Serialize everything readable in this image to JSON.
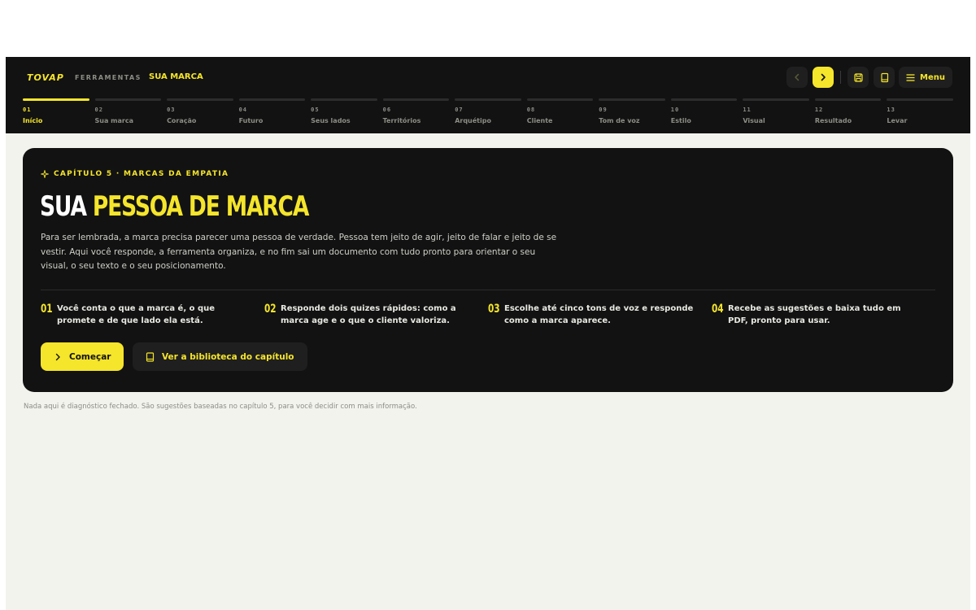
{
  "header": {
    "logo": "TOVAP",
    "tools_label": "FERRAMENTAS",
    "brand_link": "SUA MARCA",
    "menu_label": "Menu"
  },
  "icons": {
    "prev": "chevron-left-icon",
    "next": "chevron-right-icon",
    "save": "save-icon",
    "library": "book-icon",
    "menu": "hamburger-icon"
  },
  "steps": [
    {
      "num": "01",
      "label": "Início",
      "active": true
    },
    {
      "num": "02",
      "label": "Sua marca"
    },
    {
      "num": "03",
      "label": "Coração"
    },
    {
      "num": "04",
      "label": "Futuro"
    },
    {
      "num": "05",
      "label": "Seus lados"
    },
    {
      "num": "06",
      "label": "Territórios"
    },
    {
      "num": "07",
      "label": "Arquétipo"
    },
    {
      "num": "08",
      "label": "Cliente"
    },
    {
      "num": "09",
      "label": "Tom de voz"
    },
    {
      "num": "10",
      "label": "Estilo"
    },
    {
      "num": "11",
      "label": "Visual"
    },
    {
      "num": "12",
      "label": "Resultado"
    },
    {
      "num": "13",
      "label": "Levar"
    }
  ],
  "hero": {
    "eyebrow": "CAPÍTULO 5 · MARCAS DA EMPATIA",
    "title_white": "SUA",
    "title_yellow": "PESSOA DE MARCA",
    "lead": "Para ser lembrada, a marca precisa parecer uma pessoa de verdade. Pessoa tem jeito de agir, jeito de falar e jeito de se vestir. Aqui você responde, a ferramenta organiza, e no fim sai um documento com tudo pronto para orientar o seu visual, o seu texto e o seu posicionamento.",
    "points": [
      {
        "num": "01",
        "text": "Você conta o que a marca é, o que promete e de que lado ela está."
      },
      {
        "num": "02",
        "text": "Responde dois quizes rápidos: como a marca age e o que o cliente valoriza."
      },
      {
        "num": "03",
        "text": "Escolhe até cinco tons de voz e responde como a marca aparece."
      },
      {
        "num": "04",
        "text": "Recebe as sugestões e baixa tudo em PDF, pronto para usar."
      }
    ],
    "cta_primary": "Começar",
    "cta_secondary": "Ver a biblioteca do capítulo"
  },
  "footnote": "Nada aqui é diagnóstico fechado. São sugestões baseadas no capítulo 5, para você decidir com mais informação.",
  "colors": {
    "accent": "#f5e52b",
    "dark": "#121212",
    "bg": "#f3f3ee"
  }
}
